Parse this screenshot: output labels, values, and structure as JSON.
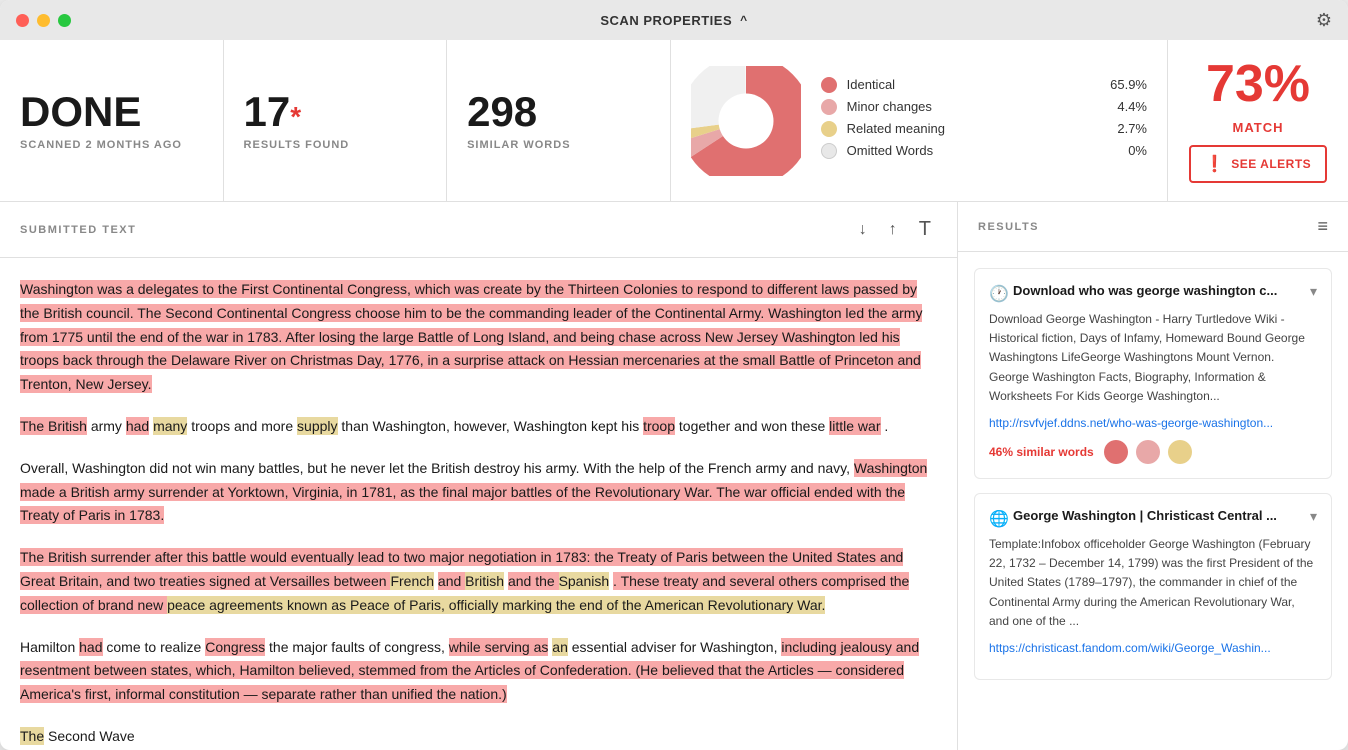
{
  "titlebar": {
    "title": "SCAN PROPERTIES",
    "chevron": "^"
  },
  "stats": {
    "status": "DONE",
    "status_sub": "SCANNED 2 MONTHS AGO",
    "results": "17",
    "results_sub": "RESULTS FOUND",
    "similar_words": "298",
    "similar_words_sub": "SIMILAR WORDS"
  },
  "chart": {
    "segments": [
      {
        "label": "Identical",
        "pct": "65.9%",
        "color": "#e07070",
        "value": 65.9
      },
      {
        "label": "Minor changes",
        "pct": "4.4%",
        "color": "#e8a8a8",
        "value": 4.4
      },
      {
        "label": "Related meaning",
        "pct": "2.7%",
        "color": "#e8d08a",
        "value": 2.7
      },
      {
        "label": "Omitted Words",
        "pct": "0%",
        "color": "#e8e8e8",
        "value": 0
      }
    ]
  },
  "match": {
    "pct": "73%",
    "label": "MATCH",
    "btn_label": "SEE ALERTS"
  },
  "left_panel": {
    "title": "SUBMITTED TEXT"
  },
  "right_panel": {
    "title": "RESULTS"
  },
  "text_blocks": [
    {
      "id": 1,
      "content": "Washington was a delegates to the First Continental Congress, which was create by the Thirteen Colonies to respond to different laws passed by the British council. The Second Continental Congress choose him to be the commanding leader of the Continental Army. Washington led the army from 1775 until the end of the war in 1783. After losing the large Battle of Long Island, and being chase across New Jersey Washington led his troops back through the Delaware River on Christmas Day, 1776, in a surprise attack on Hessian mercenaries at the small Battle of Princeton and Trenton, New Jersey."
    },
    {
      "id": 2,
      "content": "The British army had many troops and more supply than Washington, however, Washington kept his troop together and won these little war."
    },
    {
      "id": 3,
      "content": "Overall, Washington did not win many battles, but he never let the British destroy his army. With the help of the French army and navy, Washington made a British army surrender at Yorktown, Virginia, in 1781, as the final major battles of the Revolutionary War. The war official ended with the Treaty of Paris in 1783."
    },
    {
      "id": 4,
      "content": "The British surrender after this battle would eventually lead to two major negotiation in 1783: the Treaty of Paris between the United States and Great Britain, and two treaties signed at Versailles between French and British and the Spanish. These treaty and several others comprised the collection of brand new peace agreements known as Peace of Paris, officially marking the end of the American Revolutionary War."
    },
    {
      "id": 5,
      "content": "Hamilton had come to realize Congress the major faults of congress, while serving as an essential adviser for Washington, including jealousy and resentment between states, which, Hamilton believed, stemmed from the Articles of Confederation. (He believed that the Articles — considered America's first, informal constitution — separate rather than unified the nation.)"
    },
    {
      "id": 6,
      "content": "The Second Wave"
    }
  ],
  "results": [
    {
      "id": 1,
      "icon_type": "clock",
      "title": "Download who was george washington c...",
      "body": "Download George Washington - Harry Turtledove Wiki - Historical fiction, Days of Infamy, Homeward Bound George Washingtons LifeGeorge Washingtons Mount Vernon. George Washington Facts, Biography, Information & Worksheets For Kids George Washington...",
      "link": "http://rsvfvjef.ddns.net/who-was-george-washington...",
      "similar_pct": "46% similar words",
      "dots": [
        "#e07070",
        "#e8a8a8",
        "#e8d08a"
      ]
    },
    {
      "id": 2,
      "icon_type": "globe",
      "title": "George Washington | Christicast Central ...",
      "body": "Template:Infobox officeholder George Washington (February 22, 1732 – December 14, 1799) was the first President of the United States (1789–1797), the commander in chief of the Continental Army during the American Revolutionary War, and one of the ...",
      "link": "https://christicast.fandom.com/wiki/George_Washin...",
      "similar_pct": "",
      "dots": []
    }
  ],
  "icons": {
    "gear": "⚙",
    "arrow_down": "↓",
    "arrow_up": "↑",
    "font": "T",
    "filter": "≡",
    "alert": "❗"
  }
}
